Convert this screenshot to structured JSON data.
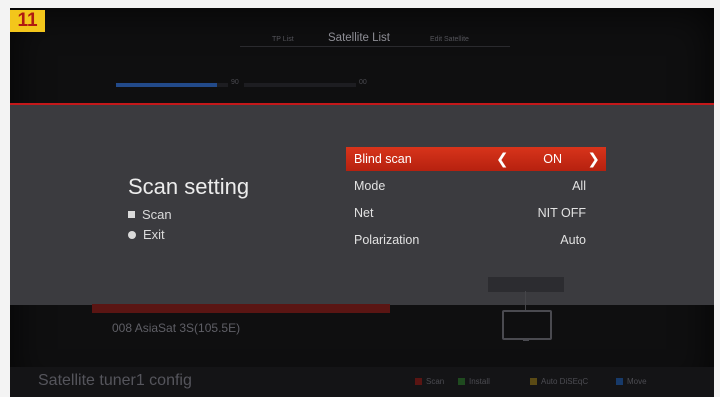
{
  "badge": {
    "number": "11"
  },
  "header": {
    "tab_left": "TP List",
    "tab_center": "Satellite List",
    "tab_right": "Edit Satellite"
  },
  "progress": [
    {
      "label": "90",
      "level": 0.9
    },
    {
      "label": "00",
      "level": 0.0
    }
  ],
  "background": {
    "satellite_item": "008 AsiaSat 3S(105.5E)"
  },
  "dialog": {
    "title": "Scan setting",
    "options": [
      {
        "icon": "square-bullet-icon",
        "label": "Scan"
      },
      {
        "icon": "circle-bullet-icon",
        "label": "Exit"
      }
    ],
    "settings": [
      {
        "label": "Blind scan",
        "value": "ON",
        "selected": true
      },
      {
        "label": "Mode",
        "value": "All",
        "selected": false
      },
      {
        "label": "Net",
        "value": "NIT OFF",
        "selected": false
      },
      {
        "label": "Polarization",
        "value": "Auto",
        "selected": false
      }
    ]
  },
  "footer": {
    "title": "Satellite tuner1 config",
    "legend": [
      {
        "color": "#b8211a",
        "label": "Scan"
      },
      {
        "color": "#2c8a2c",
        "label": "Install"
      },
      {
        "color": "#c8a020",
        "label": "Auto DiSEqC"
      },
      {
        "color": "#2060c0",
        "label": "Move"
      }
    ]
  },
  "colors": {
    "accent_red": "#c4181a",
    "badge_yellow": "#f3c61b",
    "panel": "#3b3b3f"
  }
}
